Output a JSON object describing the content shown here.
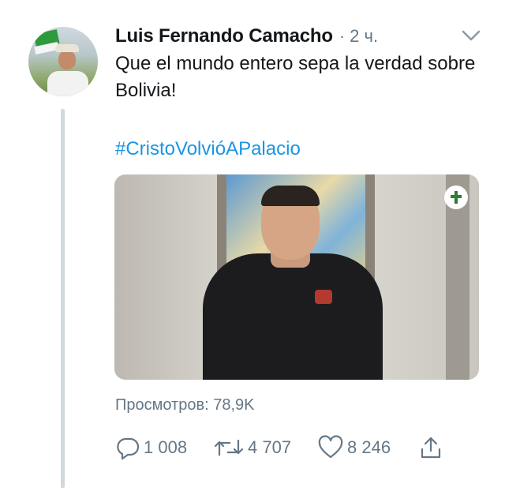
{
  "tweet": {
    "author_name": "Luis Fernando Camacho",
    "separator": "·",
    "time": "2 ч.",
    "text": "Que el mundo entero sepa la verdad sobre Bolivia!",
    "hashtag": "#CristoVolvióAPalacio",
    "views": "Просмотров: 78,9K"
  },
  "actions": {
    "reply_count": "1 008",
    "retweet_count": "4 707",
    "like_count": "8 246"
  },
  "icons": {
    "more": "chevron-down-icon",
    "reply": "reply-icon",
    "retweet": "retweet-icon",
    "like": "heart-icon",
    "share": "share-icon",
    "media_logo": "cross-emblem-icon"
  },
  "colors": {
    "link": "#1b95e0",
    "muted": "#657786",
    "text": "#14171a",
    "thread_line": "#cfd9de"
  }
}
